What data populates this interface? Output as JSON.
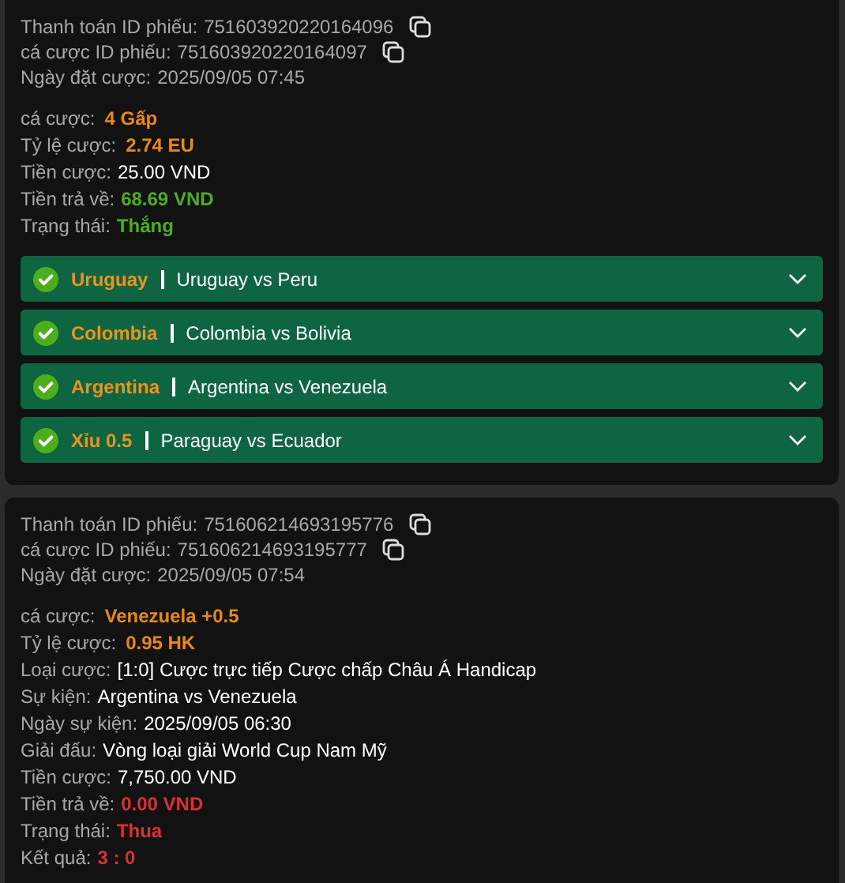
{
  "tickets": [
    {
      "ids": [
        {
          "label": "Thanh toán ID phiếu:",
          "value": "751603920220164096",
          "copyable": true
        },
        {
          "label": "cá cược ID phiếu:",
          "value": "751603920220164097",
          "copyable": true
        },
        {
          "label": "Ngày đặt cược:",
          "value": "2025/09/05 07:45",
          "copyable": false
        }
      ],
      "details": [
        {
          "label": "cá cược:",
          "value": "4 Gấp",
          "kind": "accent"
        },
        {
          "label": "Tỷ lệ cược:",
          "value": "2.74 EU",
          "kind": "accent"
        },
        {
          "label": "Tiền cược:",
          "value": "25.00 VND",
          "kind": "plain"
        },
        {
          "label": "Tiền trả về:",
          "value": "68.69 VND",
          "kind": "win"
        },
        {
          "label": "Trạng thái:",
          "value": "Thắng",
          "kind": "win"
        }
      ],
      "legs": [
        {
          "pick": "Uruguay",
          "match": "Uruguay vs Peru",
          "won": true,
          "expanded": false
        },
        {
          "pick": "Colombia",
          "match": "Colombia vs Bolivia",
          "won": true,
          "expanded": false
        },
        {
          "pick": "Argentina",
          "match": "Argentina vs Venezuela",
          "won": true,
          "expanded": false
        },
        {
          "pick": "Xỉu 0.5",
          "match": "Paraguay vs Ecuador",
          "won": true,
          "expanded": false
        }
      ]
    },
    {
      "ids": [
        {
          "label": "Thanh toán ID phiếu:",
          "value": "751606214693195776",
          "copyable": true
        },
        {
          "label": "cá cược ID phiếu:",
          "value": "751606214693195777",
          "copyable": true
        },
        {
          "label": "Ngày đặt cược:",
          "value": "2025/09/05 07:54",
          "copyable": false
        }
      ],
      "details": [
        {
          "label": "cá cược:",
          "value": "Venezuela +0.5",
          "kind": "accent"
        },
        {
          "label": "Tỷ lệ cược:",
          "value": "0.95 HK",
          "kind": "accent"
        },
        {
          "label": "Loại cược:",
          "value": "[1:0] Cược trực tiếp Cược chấp Châu Á Handicap",
          "kind": "plain"
        },
        {
          "label": "Sự kiện:",
          "value": "Argentina vs Venezuela",
          "kind": "plain"
        },
        {
          "label": "Ngày sự kiện:",
          "value": "2025/09/05 06:30",
          "kind": "plain"
        },
        {
          "label": "Giải đấu:",
          "value": "Vòng loại giải World Cup Nam Mỹ",
          "kind": "plain"
        },
        {
          "label": "Tiền cược:",
          "value": "7,750.00 VND",
          "kind": "plain"
        },
        {
          "label": "Tiền trả về:",
          "value": "0.00 VND",
          "kind": "loss"
        },
        {
          "label": "Trạng thái:",
          "value": "Thua",
          "kind": "loss"
        },
        {
          "label": "Kết quả:",
          "value": "3 : 0",
          "kind": "loss"
        }
      ]
    }
  ]
}
